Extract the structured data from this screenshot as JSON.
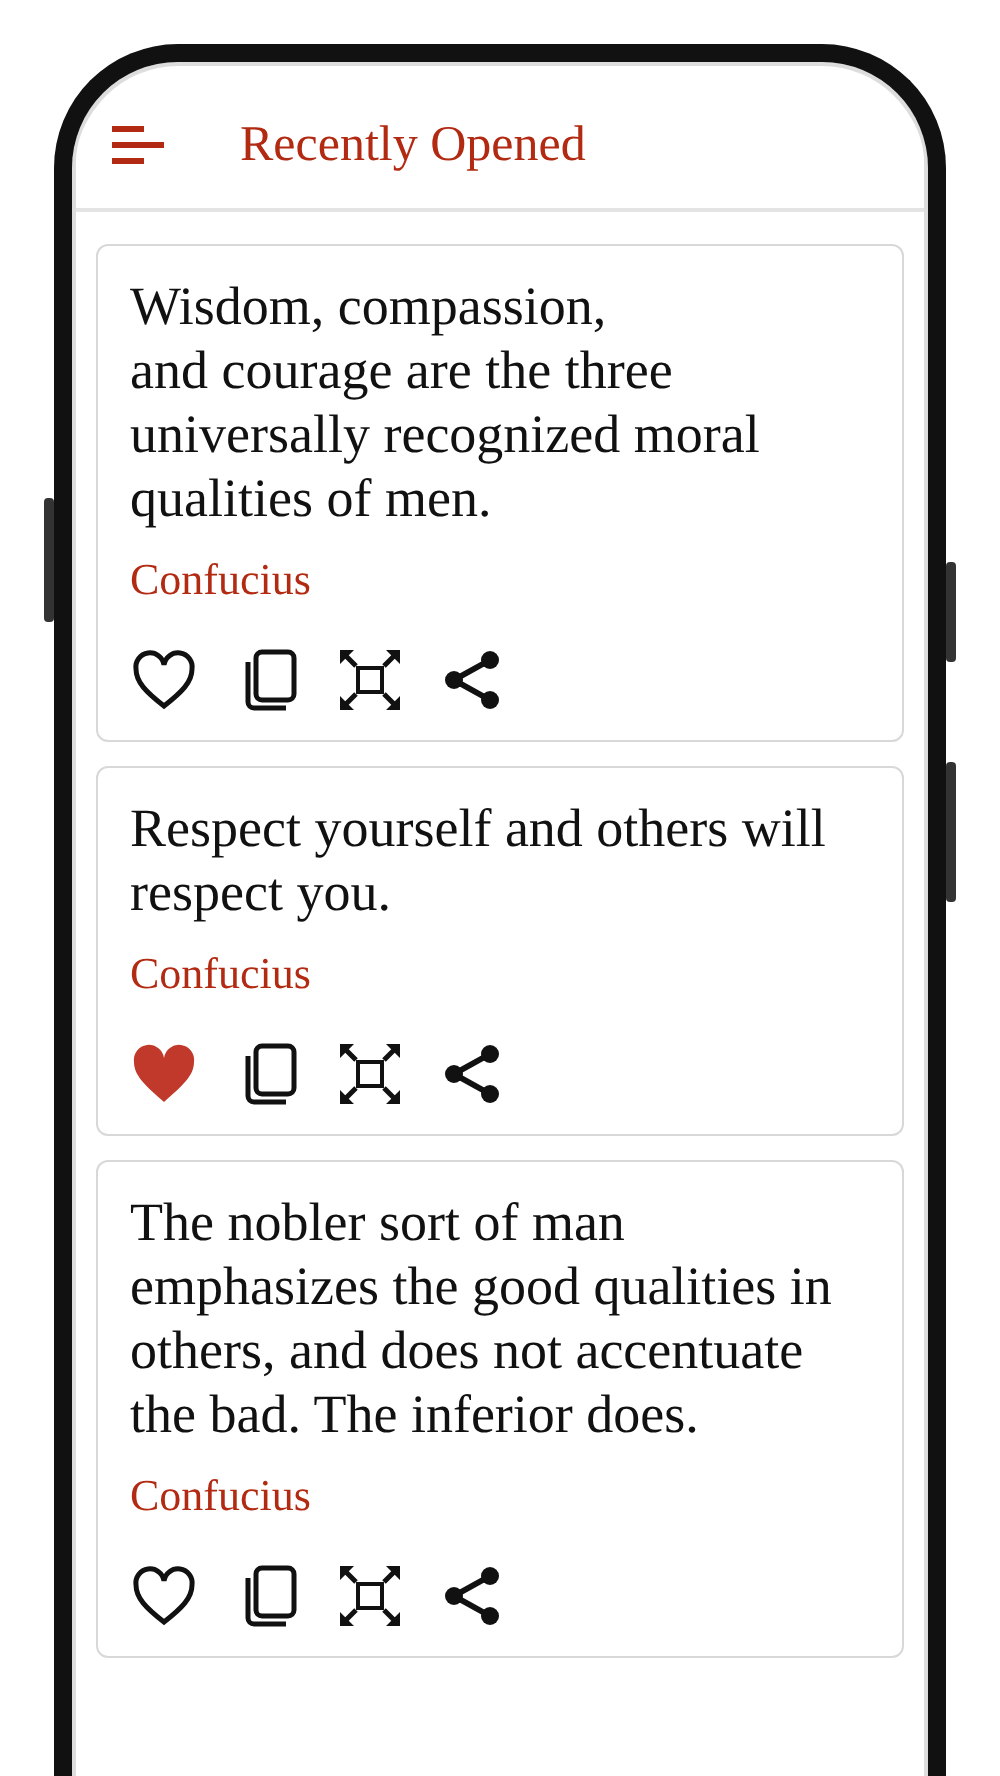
{
  "app_bar": {
    "title": "Recently Opened"
  },
  "quotes": [
    {
      "text": "Wisdom, compassion,\nand courage are the three universally recognized moral qualities of men.",
      "author": "Confucius",
      "liked": false
    },
    {
      "text": "Respect yourself and others will respect you.",
      "author": "Confucius",
      "liked": true
    },
    {
      "text": "The nobler sort of man emphasizes the good qualities in others, and does not accentuate the bad. The inferior does.",
      "author": "Confucius",
      "liked": false
    }
  ]
}
